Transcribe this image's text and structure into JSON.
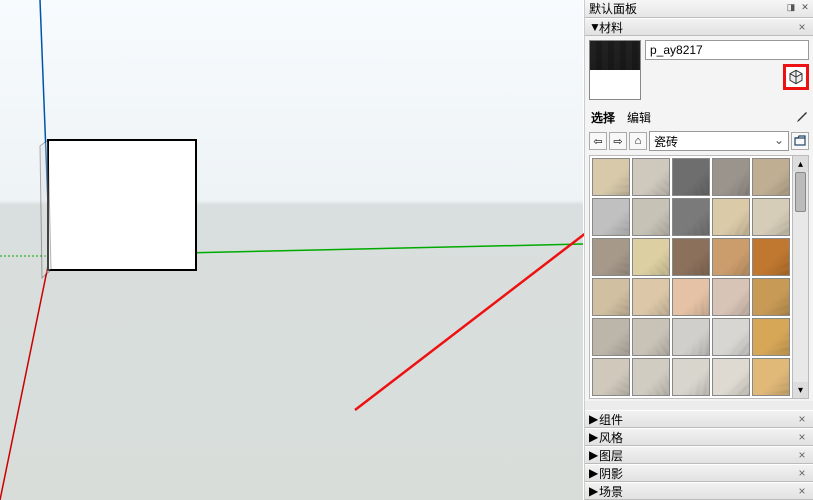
{
  "panel": {
    "title": "默认面板",
    "sections": {
      "materials": {
        "label": "材料",
        "expanded": true
      },
      "components": {
        "label": "组件"
      },
      "styles": {
        "label": "风格"
      },
      "layers": {
        "label": "图层"
      },
      "shadows": {
        "label": "阴影"
      },
      "scenes": {
        "label": "场景"
      }
    }
  },
  "material": {
    "name_value": "p_ay8217",
    "tabs": {
      "select": "选择",
      "edit": "编辑",
      "active": "select"
    },
    "category": "瓷砖"
  },
  "icons": {
    "back": "⇦",
    "fwd": "⇨",
    "home": "⌂"
  },
  "thumbs": [
    "#d8c9aa",
    "#cfc8bd",
    "#6e6e6e",
    "#9a948c",
    "#bfae92",
    "#c0c0c0",
    "#c7c2b6",
    "#7a7a7a",
    "#dacaa8",
    "#d6cdb8",
    "#a6998a",
    "#dccfa2",
    "#8b705b",
    "#cc9d6c",
    "#c0772f",
    "#d0bfa0",
    "#dcc8a8",
    "#e5c2a5",
    "#d8c4b6",
    "#c79a55",
    "#bcb5aa",
    "#c9c2b7",
    "#d1cfcb",
    "#d8d6d2",
    "#d7a758",
    "#cfc8bb",
    "#d1ccc2",
    "#d8d5cd",
    "#dedad1",
    "#e0b878"
  ]
}
